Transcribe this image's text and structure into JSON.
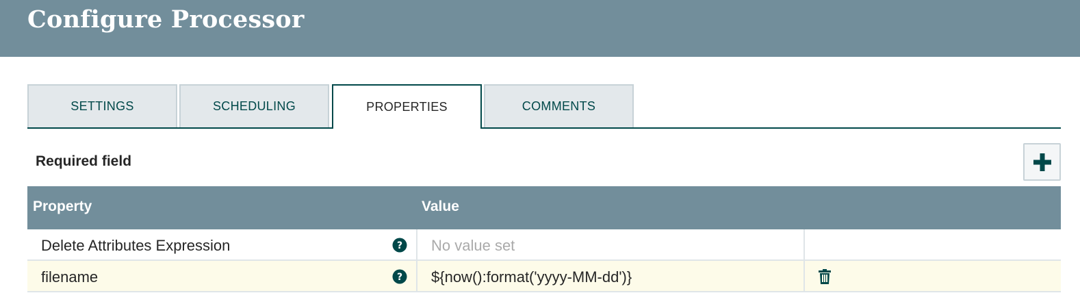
{
  "header": {
    "title": "Configure Processor"
  },
  "tabs": [
    {
      "label": "SETTINGS"
    },
    {
      "label": "SCHEDULING"
    },
    {
      "label": "PROPERTIES"
    },
    {
      "label": "COMMENTS"
    }
  ],
  "active_tab": "PROPERTIES",
  "required_field_label": "Required field",
  "add_button": {
    "icon": "plus-icon"
  },
  "grid": {
    "columns": [
      "Property",
      "Value"
    ],
    "rows": [
      {
        "property": "Delete Attributes Expression",
        "value": "No value set",
        "value_is_placeholder": true,
        "deletable": false
      },
      {
        "property": "filename",
        "value": "${now():format('yyyy-MM-dd')}",
        "value_is_placeholder": false,
        "deletable": true
      }
    ]
  },
  "colors": {
    "header_bg": "#728e9b",
    "accent": "#004849",
    "row_highlight": "#fdfbe9",
    "placeholder": "#aaaaaa"
  }
}
